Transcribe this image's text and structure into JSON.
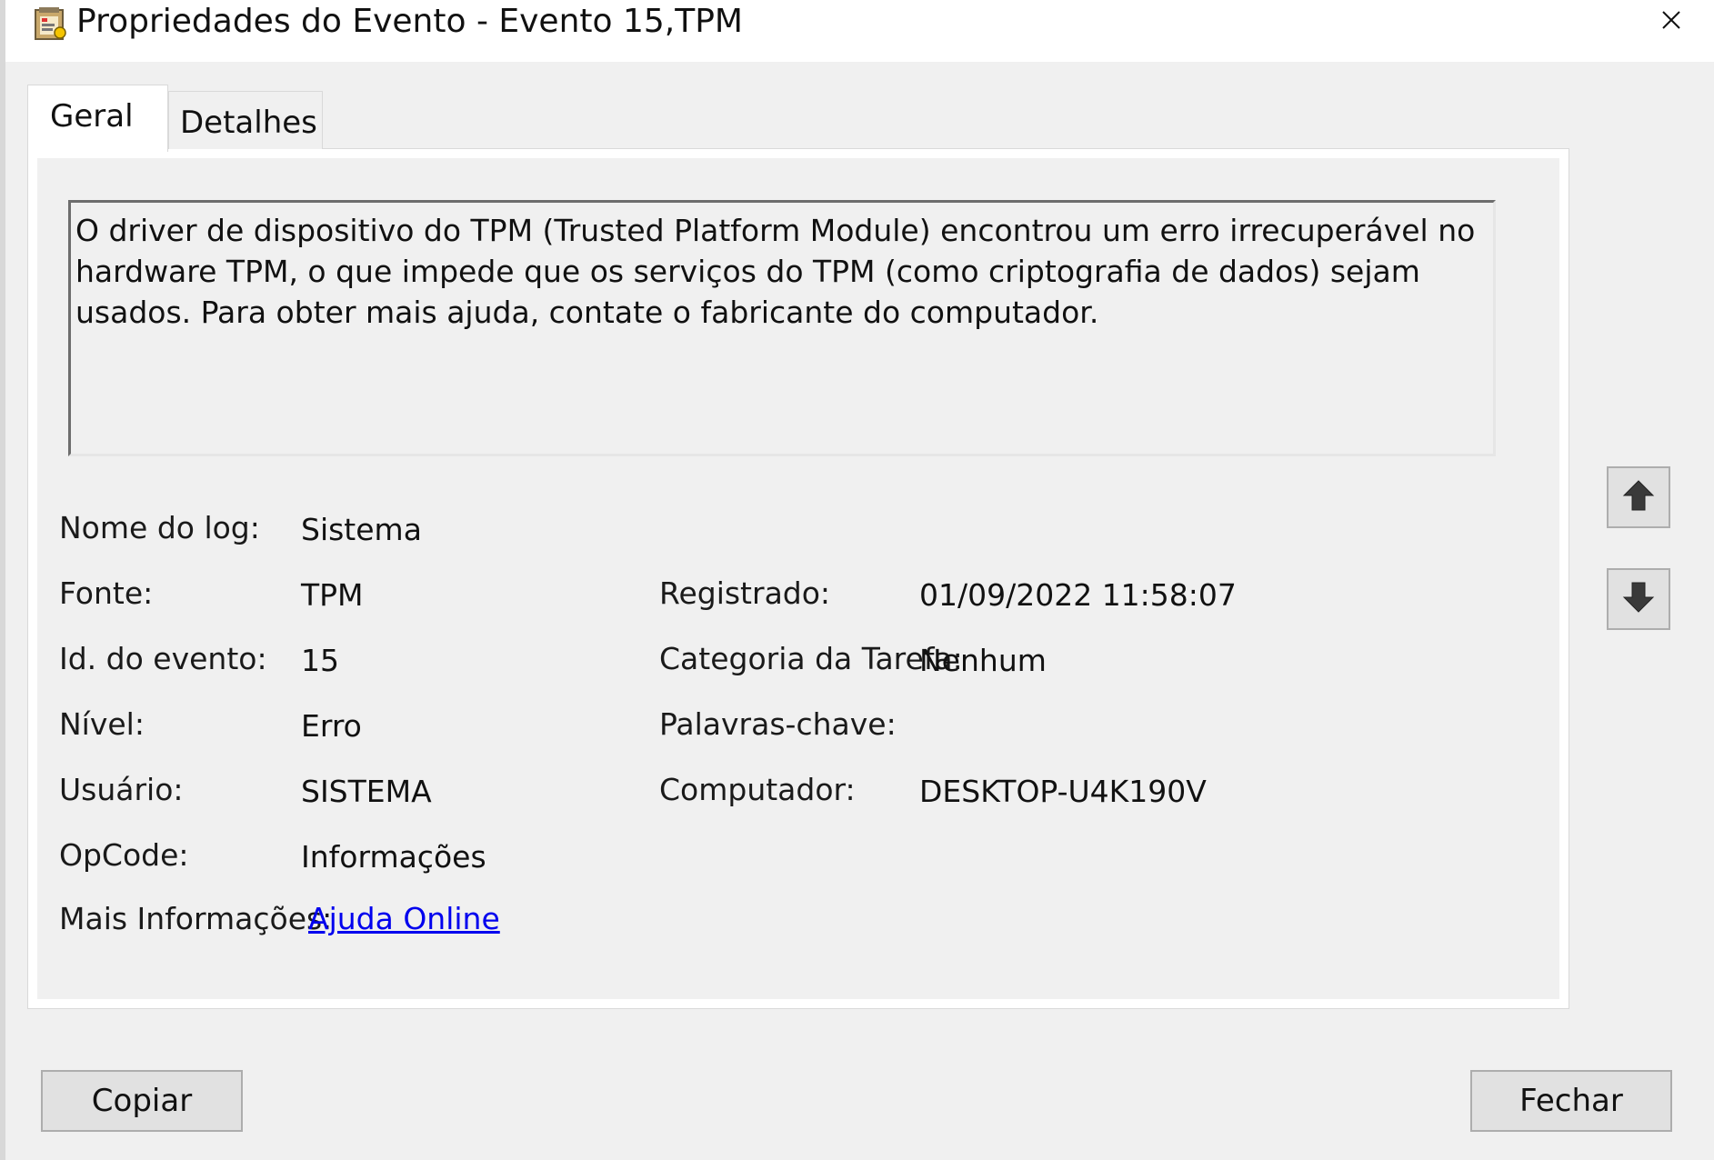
{
  "window": {
    "title": "Propriedades do Evento - Evento 15,TPM",
    "title_icon": "event-viewer-icon",
    "close_icon": "close-icon"
  },
  "tabs": [
    {
      "label": "Geral",
      "active": true
    },
    {
      "label": "Detalhes",
      "active": false
    }
  ],
  "description": "O driver de dispositivo do TPM (Trusted Platform Module) encontrou um erro irrecuperável no hardware TPM, o que impede que os serviços do TPM (como criptografia de dados) sejam usados. Para obter mais ajuda, contate o fabricante do computador.",
  "fields": {
    "log_name": {
      "label": "Nome do log:",
      "value": "Sistema"
    },
    "source": {
      "label": "Fonte:",
      "value": "TPM"
    },
    "logged": {
      "label": "Registrado:",
      "value": "01/09/2022 11:58:07"
    },
    "event_id": {
      "label": "Id. do evento:",
      "value": "15"
    },
    "task_category": {
      "label": "Categoria da Tarefa:",
      "value": "Nenhum"
    },
    "level": {
      "label": "Nível:",
      "value": "Erro"
    },
    "keywords": {
      "label": "Palavras-chave:",
      "value": ""
    },
    "user": {
      "label": "Usuário:",
      "value": "SISTEMA"
    },
    "computer": {
      "label": "Computador:",
      "value": "DESKTOP-U4K190V"
    },
    "opcode": {
      "label": "OpCode:",
      "value": "Informações"
    },
    "more_info": {
      "label": "Mais Informações:",
      "link": "Ajuda Online"
    }
  },
  "nav": {
    "up_icon": "arrow-up-icon",
    "down_icon": "arrow-down-icon"
  },
  "buttons": {
    "copy": "Copiar",
    "close": "Fechar"
  },
  "colors": {
    "link": "#0000ee",
    "dialog_bg": "#f0f0f0",
    "button_bg": "#e1e1e1"
  }
}
